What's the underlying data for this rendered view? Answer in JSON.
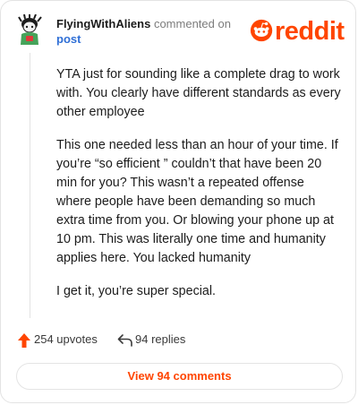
{
  "comment": {
    "author": "FlyingWithAliens",
    "action_text": "commented on",
    "target_text": "post",
    "paragraphs": [
      "YTA just for sounding like a complete drag to work with. You clearly have different standards as every other employee",
      "This one needed less than an hour of your time. If you’re “so efficient ” couldn’t that have been 20 min for you? This wasn’t a repeated offense where people have been demanding so much extra time from you. Or blowing your phone up at 10 pm. This was literally one time and humanity applies here. You lacked humanity",
      "I get it, you’re super special."
    ]
  },
  "brand": {
    "logo_text": "reddit",
    "logo_icon": "reddit-snoo-icon",
    "accent_color": "#ff4500"
  },
  "actions": {
    "upvotes_label": "254 upvotes",
    "replies_label": "94 replies",
    "upvote_icon": "upvote-arrow-icon",
    "reply_icon": "reply-arrow-icon"
  },
  "footer": {
    "view_comments_label": "View 94 comments"
  }
}
